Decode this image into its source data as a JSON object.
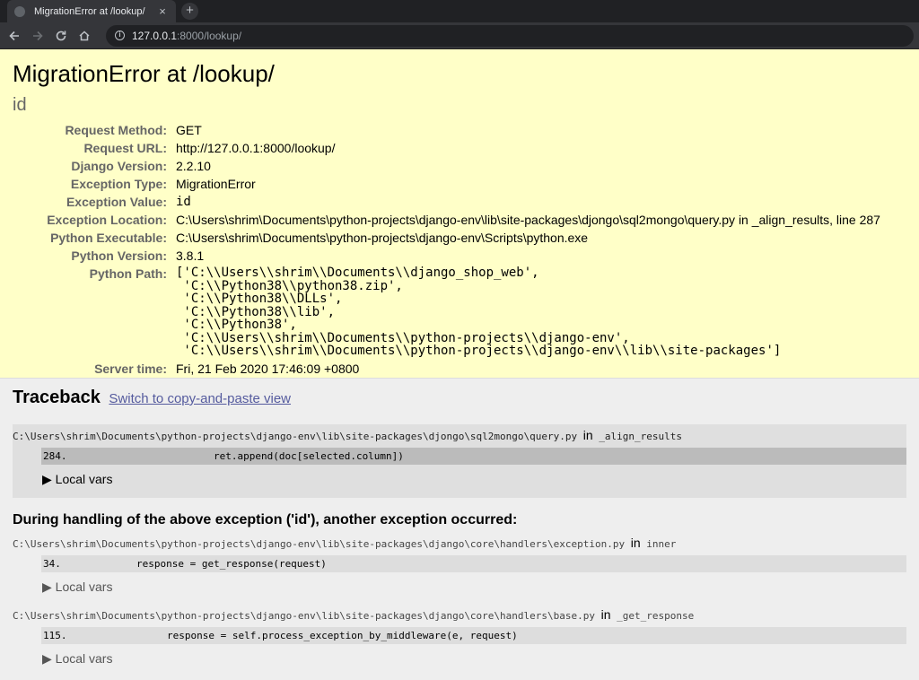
{
  "browser": {
    "tab_title": "MigrationError at /lookup/",
    "tab_close": "×",
    "new_tab": "+",
    "url_host": "127.0.0.1",
    "url_path": ":8000/lookup/"
  },
  "summary": {
    "title": "MigrationError at /lookup/",
    "exception_value": "id",
    "meta": [
      {
        "label": "Request Method:",
        "value": "GET"
      },
      {
        "label": "Request URL:",
        "value": "http://127.0.0.1:8000/lookup/"
      },
      {
        "label": "Django Version:",
        "value": "2.2.10"
      },
      {
        "label": "Exception Type:",
        "value": "MigrationError"
      },
      {
        "label": "Exception Value:",
        "value": "id"
      },
      {
        "label": "Exception Location:",
        "value": "C:\\Users\\shrim\\Documents\\python-projects\\django-env\\lib\\site-packages\\djongo\\sql2mongo\\query.py in _align_results, line 287"
      },
      {
        "label": "Python Executable:",
        "value": "C:\\Users\\shrim\\Documents\\python-projects\\django-env\\Scripts\\python.exe"
      },
      {
        "label": "Python Version:",
        "value": "3.8.1"
      },
      {
        "label": "Python Path:",
        "value": ""
      },
      {
        "label": "Server time:",
        "value": "Fri, 21 Feb 2020 17:46:09 +0800"
      }
    ],
    "python_path_lines": [
      "['C:\\\\Users\\\\shrim\\\\Documents\\\\django_shop_web',",
      " 'C:\\\\Python38\\\\python38.zip',",
      " 'C:\\\\Python38\\\\DLLs',",
      " 'C:\\\\Python38\\\\lib',",
      " 'C:\\\\Python38',",
      " 'C:\\\\Users\\\\shrim\\\\Documents\\\\python-projects\\\\django-env',",
      " 'C:\\\\Users\\\\shrim\\\\Documents\\\\python-projects\\\\django-env\\\\lib\\\\site-packages']"
    ]
  },
  "traceback": {
    "title": "Traceback",
    "switch_link": "Switch to copy-and-paste view",
    "during_text": "During handling of the above exception ('id'), another exception occurred:",
    "in_word": "in",
    "frames": [
      {
        "file": "C:\\Users\\shrim\\Documents\\python-projects\\django-env\\lib\\site-packages\\djongo\\sql2mongo\\query.py",
        "func": "_align_results",
        "line_no": "284.",
        "code": "ret.append(doc[selected.column])",
        "local_vars": "▶ Local vars"
      },
      {
        "file": "C:\\Users\\shrim\\Documents\\python-projects\\django-env\\lib\\site-packages\\django\\core\\handlers\\exception.py",
        "func": "inner",
        "line_no": "34.",
        "code": "response = get_response(request)",
        "local_vars": "▶ Local vars"
      },
      {
        "file": "C:\\Users\\shrim\\Documents\\python-projects\\django-env\\lib\\site-packages\\django\\core\\handlers\\base.py",
        "func": "_get_response",
        "line_no": "115.",
        "code": "response = self.process_exception_by_middleware(e, request)",
        "local_vars": "▶ Local vars"
      }
    ]
  }
}
